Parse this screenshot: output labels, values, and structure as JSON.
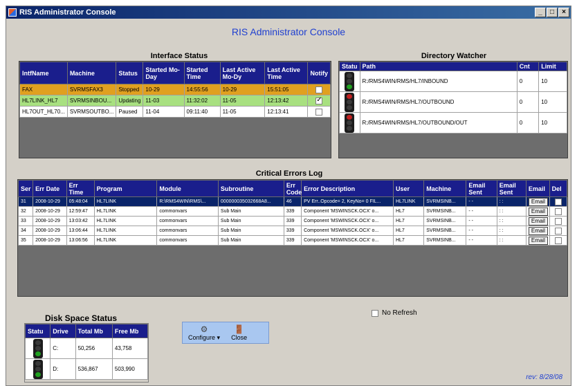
{
  "window": {
    "title": "RIS Administrator Console",
    "min_label": "_",
    "max_label": "□",
    "close_label": "×"
  },
  "app_title": "RIS Administrator Console",
  "interface_status": {
    "title": "Interface Status",
    "headers": [
      "IntfName",
      "Machine",
      "Status",
      "Started Mo-Day",
      "Started Time",
      "Last Active Mo-Dy",
      "Last Active Time",
      "Notify"
    ],
    "rows": [
      {
        "name": "FAX",
        "machine": "SVRMSFAX3",
        "status": "Stopped",
        "start_md": "10-29",
        "start_time": "14:55:56",
        "last_md": "10-29",
        "last_time": "15:51:05",
        "notify": false,
        "color": "#e0a020"
      },
      {
        "name": "HL7LINK_HL7",
        "machine": "SVRMSINBOU...",
        "status": "Updating",
        "start_md": "11-03",
        "start_time": "11:32:02",
        "last_md": "11-05",
        "last_time": "12:13:42",
        "notify": true,
        "color": "#a8e080"
      },
      {
        "name": "HL7OUT_HL70...",
        "machine": "SVRMSOUTBO...",
        "status": "Paused",
        "start_md": "11-04",
        "start_time": "09:11:40",
        "last_md": "11-05",
        "last_time": "12:13:41",
        "notify": false,
        "color": "#ffffff"
      }
    ]
  },
  "directory_watcher": {
    "title": "Directory Watcher",
    "headers": [
      "Statu",
      "Path",
      "Cnt",
      "Limit"
    ],
    "rows": [
      {
        "path": "R:/RMS4WIN/RMS/HL7/INBOUND",
        "cnt": "0",
        "limit": "10",
        "light": "g"
      },
      {
        "path": "R:/RMS4WIN/RMS/HL7/OUTBOUND",
        "cnt": "0",
        "limit": "10",
        "light": "r"
      },
      {
        "path": "R:/RMS4WIN/RMS/HL7/OUTBOUND/OUT",
        "cnt": "0",
        "limit": "10",
        "light": "r"
      }
    ]
  },
  "critical_errors": {
    "title": "Critical Errors Log",
    "headers": [
      "Ser",
      "Err Date",
      "Err Time",
      "Program",
      "Module",
      "Subroutine",
      "Err Code",
      "Error Description",
      "User",
      "Machine",
      "Email Sent",
      "Email Sent",
      "Email",
      "Del"
    ],
    "rows": [
      {
        "ser": "31",
        "date": "2008-10-29",
        "time": "05:48:04",
        "program": "HL7LINK",
        "module": "R:\\RMS4WIN\\RMS\\...",
        "sub": "000000035032668A8...",
        "code": "46",
        "desc": "PV Err..Opcode= 2, KeyNo= 0 FIL...",
        "user": "HL7LINK",
        "machine": "SVRMSINB...",
        "sent1": "- -",
        "sent2": ": :",
        "email": "Email",
        "selected": true
      },
      {
        "ser": "32",
        "date": "2008-10-29",
        "time": "12:59:47",
        "program": "HL7LINK",
        "module": "commonvars",
        "sub": "Sub Main",
        "code": "339",
        "desc": "Component 'MSWINSCK.OCX' o...",
        "user": "HL7",
        "machine": "SVRMSINB...",
        "sent1": "- -",
        "sent2": ": :",
        "email": "Email",
        "selected": false
      },
      {
        "ser": "33",
        "date": "2008-10-29",
        "time": "13:03:42",
        "program": "HL7LINK",
        "module": "commonvars",
        "sub": "Sub Main",
        "code": "339",
        "desc": "Component 'MSWINSCK.OCX' o...",
        "user": "HL7",
        "machine": "SVRMSINB...",
        "sent1": "- -",
        "sent2": ": :",
        "email": "Email",
        "selected": false
      },
      {
        "ser": "34",
        "date": "2008-10-29",
        "time": "13:06:44",
        "program": "HL7LINK",
        "module": "commonvars",
        "sub": "Sub Main",
        "code": "339",
        "desc": "Component 'MSWINSCK.OCX' o...",
        "user": "HL7",
        "machine": "SVRMSINB...",
        "sent1": "- -",
        "sent2": ": :",
        "email": "Email",
        "selected": false
      },
      {
        "ser": "35",
        "date": "2008-10-29",
        "time": "13:06:56",
        "program": "HL7LINK",
        "module": "commonvars",
        "sub": "Sub Main",
        "code": "339",
        "desc": "Component 'MSWINSCK.OCX' o...",
        "user": "HL7",
        "machine": "SVRMSINB...",
        "sent1": "- -",
        "sent2": ": :",
        "email": "Email",
        "selected": false
      }
    ]
  },
  "no_refresh": {
    "label": "No Refresh",
    "checked": false
  },
  "disk_space": {
    "title": "Disk Space Status",
    "headers": [
      "Statu",
      "Drive",
      "Total Mb",
      "Free Mb"
    ],
    "rows": [
      {
        "drive": "C:",
        "total": "50,256",
        "free": "43,758",
        "light": "g"
      },
      {
        "drive": "D:",
        "total": "536,867",
        "free": "503,990",
        "light": "g"
      }
    ]
  },
  "toolbar": {
    "configure_label": "Configure",
    "close_label": "Close"
  },
  "revision": "rev: 8/28/08"
}
